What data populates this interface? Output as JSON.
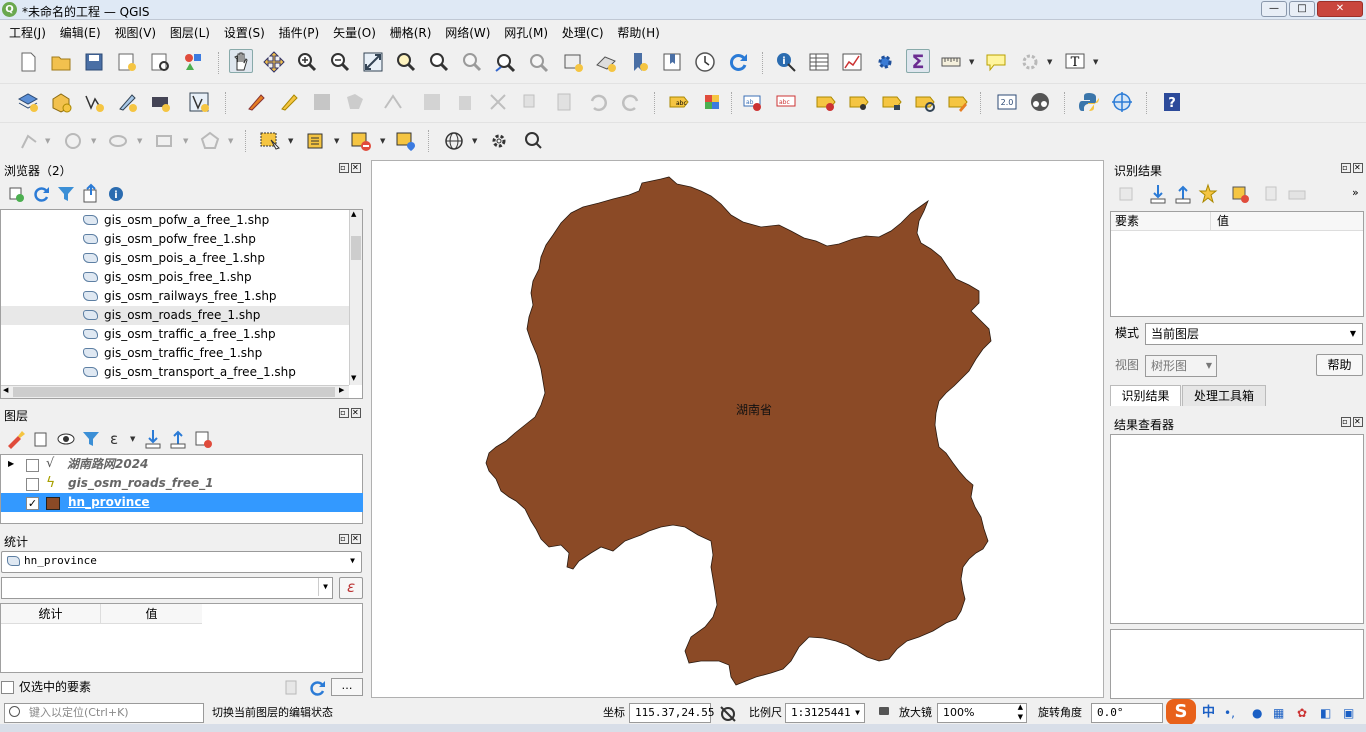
{
  "window": {
    "title": "*未命名的工程 — QGIS",
    "min": "—",
    "max": "□",
    "close": "✕"
  },
  "menu": [
    "工程(J)",
    "编辑(E)",
    "视图(V)",
    "图层(L)",
    "设置(S)",
    "插件(P)",
    "矢量(O)",
    "栅格(R)",
    "网络(W)",
    "网孔(M)",
    "处理(C)",
    "帮助(H)"
  ],
  "browser": {
    "title": "浏览器（2）",
    "files": [
      "gis_osm_pofw_a_free_1.shp",
      "gis_osm_pofw_free_1.shp",
      "gis_osm_pois_a_free_1.shp",
      "gis_osm_pois_free_1.shp",
      "gis_osm_railways_free_1.shp",
      "gis_osm_roads_free_1.shp",
      "gis_osm_traffic_a_free_1.shp",
      "gis_osm_traffic_free_1.shp",
      "gis_osm_transport_a_free_1.shp"
    ],
    "selected_index": 5
  },
  "layers": {
    "title": "图层",
    "items": [
      {
        "name": "湖南路网2024",
        "checked": false,
        "type": "vector-line-icon"
      },
      {
        "name": "gis_osm_roads_free_1",
        "checked": false,
        "type": "line-layer-icon"
      },
      {
        "name": "hn_province",
        "checked": true,
        "type": "polygon-layer-icon",
        "color": "#8b4a26",
        "selected": true
      }
    ]
  },
  "stats": {
    "title": "统计",
    "layer": "hn_province",
    "field": "",
    "col_stat": "统计",
    "col_value": "值",
    "only_selected": "仅选中的要素",
    "more": "…"
  },
  "map": {
    "label": "湖南省",
    "fill": "#8b4a26"
  },
  "identify": {
    "title": "识别结果",
    "col_feature": "要素",
    "col_value": "值",
    "mode_label": "模式",
    "mode_value": "当前图层",
    "view_label": "视图",
    "view_value": "树形图",
    "help": "帮助",
    "tab1": "识别结果",
    "tab2": "处理工具箱"
  },
  "results": {
    "title": "结果查看器"
  },
  "statusbar": {
    "locate_placeholder": "键入以定位(Ctrl+K)",
    "message": "切换当前图层的编辑状态",
    "coord_label": "坐标",
    "coord_value": "115.37,24.55",
    "scale_label": "比例尺",
    "scale_value": "1:3125441",
    "magnifier_label": "放大镜",
    "magnifier_value": "100%",
    "rotation_label": "旋转角度",
    "rotation_value": "0.0°"
  },
  "ime": {
    "lang": "中"
  }
}
